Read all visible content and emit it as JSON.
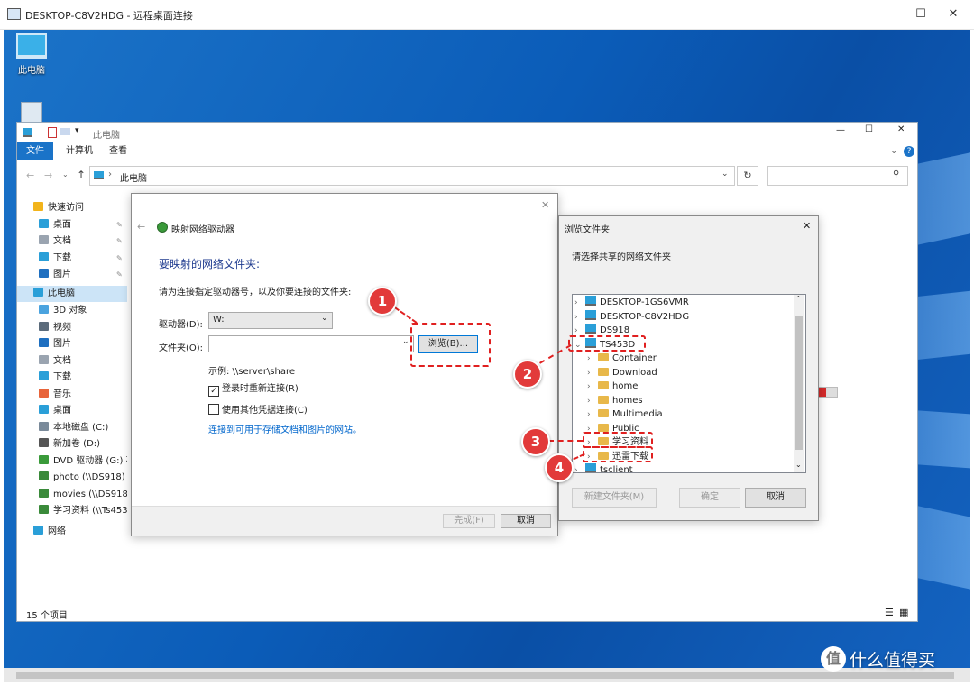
{
  "rdp": {
    "title": "DESKTOP-C8V2HDG - 远程桌面连接",
    "min": "—",
    "max": "☐",
    "close": "✕"
  },
  "desktop": {
    "icons": [
      {
        "label": "此电脑"
      },
      {
        "label": ""
      }
    ]
  },
  "explorer": {
    "title": "此电脑",
    "tabs": [
      "文件",
      "计算机",
      "查看"
    ],
    "address": "此电脑",
    "search_placeholder": "",
    "nav": [
      {
        "label": "快速访问",
        "icon": "star-icon",
        "color": "#f2b41b",
        "level": 0
      },
      {
        "label": "桌面",
        "icon": "desktop-icon",
        "color": "#2a9fd8",
        "level": 1,
        "pin": true
      },
      {
        "label": "文档",
        "icon": "document-icon",
        "color": "#9aa4b0",
        "level": 1,
        "pin": true
      },
      {
        "label": "下载",
        "icon": "download-icon",
        "color": "#2a9fd8",
        "level": 1,
        "pin": true
      },
      {
        "label": "图片",
        "icon": "pictures-icon",
        "color": "#1e6fc0",
        "level": 1,
        "pin": true
      },
      {
        "label": "此电脑",
        "icon": "computer-icon",
        "color": "#2a9fd8",
        "level": 0,
        "selected": true
      },
      {
        "label": "3D 对象",
        "icon": "3d-icon",
        "color": "#4aa3df",
        "level": 1
      },
      {
        "label": "视频",
        "icon": "video-icon",
        "color": "#5b6b7b",
        "level": 1
      },
      {
        "label": "图片",
        "icon": "pictures-icon",
        "color": "#1e6fc0",
        "level": 1
      },
      {
        "label": "文档",
        "icon": "document-icon",
        "color": "#9aa4b0",
        "level": 1
      },
      {
        "label": "下载",
        "icon": "download-icon",
        "color": "#2a9fd8",
        "level": 1
      },
      {
        "label": "音乐",
        "icon": "music-icon",
        "color": "#e8643a",
        "level": 1
      },
      {
        "label": "桌面",
        "icon": "desktop-icon",
        "color": "#2a9fd8",
        "level": 1
      },
      {
        "label": "本地磁盘 (C:)",
        "icon": "drive-icon",
        "color": "#7a8a9a",
        "level": 1
      },
      {
        "label": "新加卷 (D:)",
        "icon": "drive-icon",
        "color": "#555555",
        "level": 1
      },
      {
        "label": "DVD 驱动器 (G:) 不",
        "icon": "dvd-icon",
        "color": "#3a9a3a",
        "level": 1
      },
      {
        "label": "photo (\\\\DS918) (",
        "icon": "network-drive-icon",
        "color": "#3a8a3a",
        "level": 1
      },
      {
        "label": "movies (\\\\DS918)",
        "icon": "network-drive-icon",
        "color": "#3a8a3a",
        "level": 1
      },
      {
        "label": "学习资料 (\\\\Ts453",
        "icon": "network-drive-icon",
        "color": "#3a8a3a",
        "level": 1
      },
      {
        "label": "网络",
        "icon": "network-icon",
        "color": "#2a9fd8",
        "level": 0
      }
    ],
    "status": "15 个项目"
  },
  "mapdrive": {
    "title": "映射网络驱动器",
    "heading": "要映射的网络文件夹:",
    "instruction": "请为连接指定驱动器号，以及你要连接的文件夹:",
    "drive_label": "驱动器(D):",
    "drive_value": "W:",
    "folder_label": "文件夹(O):",
    "folder_value": "",
    "browse": "浏览(B)...",
    "example": "示例: \\\\server\\share",
    "reconnect": "登录时重新连接(R)",
    "reconnect_checked": true,
    "other_creds": "使用其他凭据连接(C)",
    "other_creds_checked": false,
    "link": "连接到可用于存储文档和图片的网站。",
    "finish": "完成(F)",
    "cancel": "取消"
  },
  "browse": {
    "title": "浏览文件夹",
    "instruction": "请选择共享的网络文件夹",
    "tree": [
      {
        "label": "DESKTOP-1GS6VMR",
        "type": "pc",
        "level": 0,
        "exp": "›"
      },
      {
        "label": "DESKTOP-C8V2HDG",
        "type": "pc",
        "level": 0,
        "exp": "›"
      },
      {
        "label": "DS918",
        "type": "pc",
        "level": 0,
        "exp": "›"
      },
      {
        "label": "TS453D",
        "type": "pc",
        "level": 0,
        "exp": "⌄"
      },
      {
        "label": "Container",
        "type": "folder",
        "level": 1,
        "exp": "›"
      },
      {
        "label": "Download",
        "type": "folder",
        "level": 1,
        "exp": "›"
      },
      {
        "label": "home",
        "type": "folder",
        "level": 1,
        "exp": "›"
      },
      {
        "label": "homes",
        "type": "folder",
        "level": 1,
        "exp": "›"
      },
      {
        "label": "Multimedia",
        "type": "folder",
        "level": 1,
        "exp": "›"
      },
      {
        "label": "Public",
        "type": "folder",
        "level": 1,
        "exp": "›"
      },
      {
        "label": "学习资料",
        "type": "folder",
        "level": 1,
        "exp": "›"
      },
      {
        "label": "迅雷下载",
        "type": "folder",
        "level": 1,
        "exp": "›"
      },
      {
        "label": "tsclient",
        "type": "pc",
        "level": 0,
        "exp": "›"
      }
    ],
    "new_folder": "新建文件夹(M)",
    "ok": "确定",
    "cancel": "取消"
  },
  "callouts": [
    "1",
    "2",
    "3",
    "4"
  ],
  "watermark": {
    "icon": "zhi-icon",
    "text": "什么值得买"
  }
}
